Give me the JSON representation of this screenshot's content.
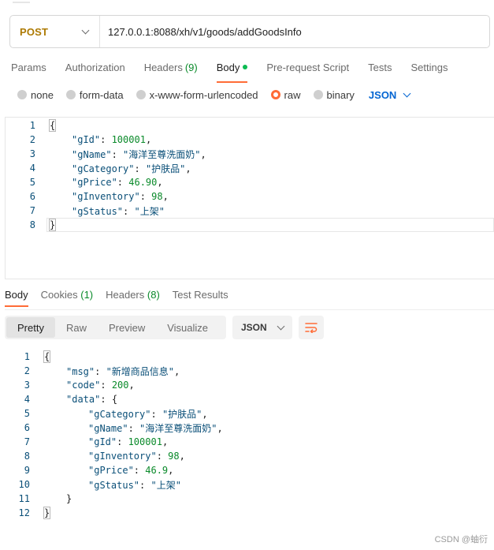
{
  "request": {
    "method": "POST",
    "url": "127.0.0.1:8088/xh/v1/goods/addGoodsInfo"
  },
  "request_tabs": [
    {
      "label": "Params",
      "count": ""
    },
    {
      "label": "Authorization",
      "count": ""
    },
    {
      "label": "Headers",
      "count": "(9)"
    },
    {
      "label": "Body",
      "count": ""
    },
    {
      "label": "Pre-request Script",
      "count": ""
    },
    {
      "label": "Tests",
      "count": ""
    },
    {
      "label": "Settings",
      "count": ""
    }
  ],
  "body_types": [
    "none",
    "form-data",
    "x-www-form-urlencoded",
    "raw",
    "binary"
  ],
  "body_type_selected": "raw",
  "body_format": "JSON",
  "request_body": [
    {
      "ln": "1",
      "indent": 0,
      "text": "{"
    },
    {
      "ln": "2",
      "indent": 1,
      "key": "\"gId\"",
      "val": "100001",
      "vtype": "n",
      "comma": ","
    },
    {
      "ln": "3",
      "indent": 1,
      "key": "\"gName\"",
      "val": "\"海洋至尊洗面奶\"",
      "vtype": "s",
      "comma": ","
    },
    {
      "ln": "4",
      "indent": 1,
      "key": "\"gCategory\"",
      "val": "\"护肤品\"",
      "vtype": "s",
      "comma": ","
    },
    {
      "ln": "5",
      "indent": 1,
      "key": "\"gPrice\"",
      "val": "46.90",
      "vtype": "n",
      "comma": ","
    },
    {
      "ln": "6",
      "indent": 1,
      "key": "\"gInventory\"",
      "val": "98",
      "vtype": "n",
      "comma": ","
    },
    {
      "ln": "7",
      "indent": 1,
      "key": "\"gStatus\"",
      "val": "\"上架\"",
      "vtype": "s",
      "comma": ""
    },
    {
      "ln": "8",
      "indent": 0,
      "text": "}"
    }
  ],
  "response_tabs": [
    {
      "label": "Body",
      "count": ""
    },
    {
      "label": "Cookies",
      "count": "(1)"
    },
    {
      "label": "Headers",
      "count": "(8)"
    },
    {
      "label": "Test Results",
      "count": ""
    }
  ],
  "view_modes": [
    "Pretty",
    "Raw",
    "Preview",
    "Visualize"
  ],
  "view_mode_selected": "Pretty",
  "response_format": "JSON",
  "response_body": [
    {
      "ln": "1",
      "indent": 0,
      "text": "{"
    },
    {
      "ln": "2",
      "indent": 1,
      "key": "\"msg\"",
      "val": "\"新增商品信息\"",
      "vtype": "s",
      "comma": ","
    },
    {
      "ln": "3",
      "indent": 1,
      "key": "\"code\"",
      "val": "200",
      "vtype": "n",
      "comma": ","
    },
    {
      "ln": "4",
      "indent": 1,
      "key": "\"data\"",
      "val": "{",
      "vtype": "p",
      "comma": ""
    },
    {
      "ln": "5",
      "indent": 2,
      "key": "\"gCategory\"",
      "val": "\"护肤品\"",
      "vtype": "s",
      "comma": ","
    },
    {
      "ln": "6",
      "indent": 2,
      "key": "\"gName\"",
      "val": "\"海洋至尊洗面奶\"",
      "vtype": "s",
      "comma": ","
    },
    {
      "ln": "7",
      "indent": 2,
      "key": "\"gId\"",
      "val": "100001",
      "vtype": "n",
      "comma": ","
    },
    {
      "ln": "8",
      "indent": 2,
      "key": "\"gInventory\"",
      "val": "98",
      "vtype": "n",
      "comma": ","
    },
    {
      "ln": "9",
      "indent": 2,
      "key": "\"gPrice\"",
      "val": "46.9",
      "vtype": "n",
      "comma": ","
    },
    {
      "ln": "10",
      "indent": 2,
      "key": "\"gStatus\"",
      "val": "\"上架\"",
      "vtype": "s",
      "comma": ""
    },
    {
      "ln": "11",
      "indent": 1,
      "text": "}"
    },
    {
      "ln": "12",
      "indent": 0,
      "text": "}"
    }
  ],
  "watermark": "CSDN @蚰衍",
  "colors": {
    "accent": "#ff6c37",
    "method": "#ad7a03",
    "link": "#0265d2",
    "count": "#0a8a2a"
  },
  "icons": {
    "wrap": "wrap-lines-icon",
    "dropdown": "chevron-down-icon"
  }
}
